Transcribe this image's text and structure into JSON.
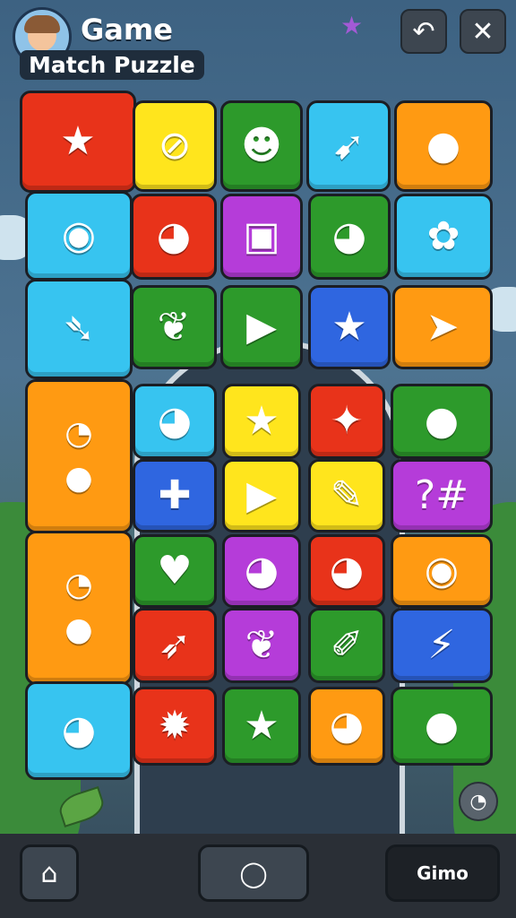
{
  "header": {
    "title_line1": "Game",
    "title_line2": "Match Puzzle"
  },
  "colors": {
    "red": "#e8331a",
    "yellow": "#ffe51d",
    "green": "#2d9a2b",
    "cyan": "#37c4f0",
    "orange": "#ff9a12",
    "purple": "#b53cd9",
    "blue": "#2f66e0"
  },
  "icons": {
    "star": "★",
    "heart": "♥",
    "smile": "☻",
    "leaf": "❦",
    "play": "▶",
    "cross": "✚",
    "cat": "◕",
    "drop": "●",
    "bolt": "⚡",
    "circle": "◯"
  },
  "board": {
    "tiles": [
      {
        "color": "red",
        "icon": "star-icon",
        "glyph": "★"
      },
      {
        "color": "yellow",
        "icon": "ladle-icon",
        "glyph": "⊘"
      },
      {
        "color": "green",
        "icon": "smiley-icon",
        "glyph": "☻"
      },
      {
        "color": "cyan",
        "icon": "carrot-icon",
        "glyph": "➹"
      },
      {
        "color": "orange",
        "icon": "pepper-icon",
        "glyph": "●"
      },
      {
        "color": "cyan",
        "icon": "monkey-icon",
        "glyph": "◉"
      },
      {
        "color": "red",
        "icon": "cat-face-icon",
        "glyph": "◕"
      },
      {
        "color": "purple",
        "icon": "box-icon",
        "glyph": "▣"
      },
      {
        "color": "green",
        "icon": "fox-face-icon",
        "glyph": "◕"
      },
      {
        "color": "cyan",
        "icon": "bush-icon",
        "glyph": "✿"
      },
      {
        "color": "cyan",
        "icon": "fish-icon",
        "glyph": "➴"
      },
      {
        "color": "green",
        "icon": "leaf-icon",
        "glyph": "❦"
      },
      {
        "color": "green",
        "icon": "play-icon",
        "glyph": "▶"
      },
      {
        "color": "blue",
        "icon": "star-icon",
        "glyph": "★"
      },
      {
        "color": "orange",
        "icon": "arrow-icon",
        "glyph": "➤"
      },
      {
        "color": "orange",
        "icon": "bubble-fruit-icon",
        "glyph": "◔"
      },
      {
        "color": "cyan",
        "icon": "cat-face-icon",
        "glyph": "◕"
      },
      {
        "color": "yellow",
        "icon": "star-icon",
        "glyph": "★"
      },
      {
        "color": "red",
        "icon": "candy-icon",
        "glyph": "✦"
      },
      {
        "color": "green",
        "icon": "fruit-pair-icon",
        "glyph": "●"
      },
      {
        "color": "blue",
        "icon": "cross-icon",
        "glyph": "✚"
      },
      {
        "color": "yellow",
        "icon": "play-icon",
        "glyph": "▶"
      },
      {
        "color": "yellow",
        "icon": "pen-icon",
        "glyph": "✎"
      },
      {
        "color": "purple",
        "icon": "question-hash-icon",
        "glyph": "?#"
      },
      {
        "color": "orange",
        "icon": "bubble-fruit-icon",
        "glyph": "◔"
      },
      {
        "color": "green",
        "icon": "strawberry-icon",
        "glyph": "♥"
      },
      {
        "color": "purple",
        "icon": "cat-face-icon",
        "glyph": "◕"
      },
      {
        "color": "red",
        "icon": "rabbit-icon",
        "glyph": "◕"
      },
      {
        "color": "orange",
        "icon": "lollipop-ball-icon",
        "glyph": "◉"
      },
      {
        "color": "red",
        "icon": "feather-icon",
        "glyph": "➶"
      },
      {
        "color": "purple",
        "icon": "leaf-icon",
        "glyph": "❦"
      },
      {
        "color": "green",
        "icon": "brush-icon",
        "glyph": "✐"
      },
      {
        "color": "blue",
        "icon": "zigzag-icon",
        "glyph": "⚡"
      },
      {
        "color": "cyan",
        "icon": "cat-face-icon",
        "glyph": "◕"
      },
      {
        "color": "red",
        "icon": "gear-icon",
        "glyph": "✹"
      },
      {
        "color": "green",
        "icon": "star-icon",
        "glyph": "★"
      },
      {
        "color": "orange",
        "icon": "cat-face-icon",
        "glyph": "◕"
      },
      {
        "color": "green",
        "icon": "drop-pair-icon",
        "glyph": "●"
      }
    ]
  },
  "bottom_bar": {
    "right_button_label": "Gimo"
  }
}
